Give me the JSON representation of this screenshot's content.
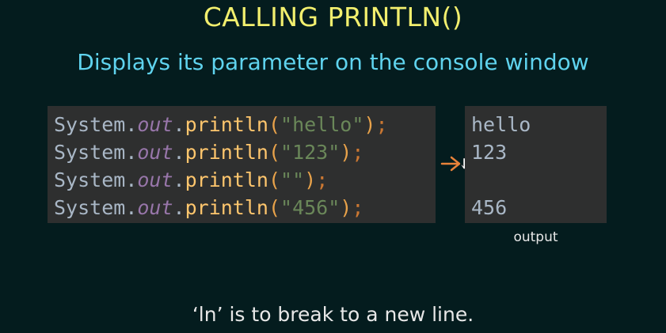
{
  "slide": {
    "title": "CALLING PRINTLN()",
    "subtitle": "Displays its parameter on the console window",
    "footer": "‘ln’ is to break to a new line.",
    "output_label": "output"
  },
  "code": {
    "lines": [
      {
        "obj": "System",
        "dot1": ".",
        "field": "out",
        "dot2": ".",
        "method": "println",
        "open": "(",
        "str": "\"hello\"",
        "close": ")",
        "semi": ";"
      },
      {
        "obj": "System",
        "dot1": ".",
        "field": "out",
        "dot2": ".",
        "method": "println",
        "open": "(",
        "str": "\"123\"",
        "close": ")",
        "semi": ";"
      },
      {
        "obj": "System",
        "dot1": ".",
        "field": "out",
        "dot2": ".",
        "method": "println",
        "open": "(",
        "str": "\"\"",
        "close": ")",
        "semi": ";"
      },
      {
        "obj": "System",
        "dot1": ".",
        "field": "out",
        "dot2": ".",
        "method": "println",
        "open": "(",
        "str": "\"456\"",
        "close": ")",
        "semi": ";"
      }
    ]
  },
  "output": {
    "lines": [
      "hello",
      "123",
      "",
      "456"
    ]
  },
  "icons": {
    "arrow": "arrow-right-icon",
    "cursor": "mouse-pointer-icon"
  },
  "colors": {
    "background": "#041c1e",
    "title": "#f2ef6e",
    "subtitle": "#5fd3ee",
    "panel": "#2e2f2f",
    "arrow": "#e8823a"
  }
}
